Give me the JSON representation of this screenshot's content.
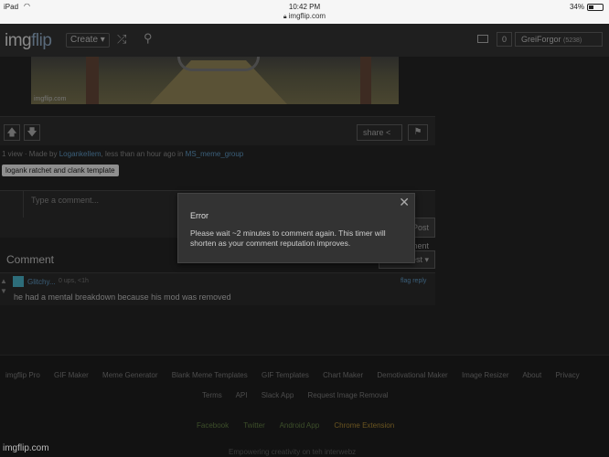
{
  "status_bar": {
    "device": "iPad",
    "time": "10:42 PM",
    "url": "imgflip.com",
    "battery": "34%"
  },
  "nav": {
    "logo_main": "img",
    "logo_accent": "flip",
    "create_label": "Create",
    "notifications": "0",
    "username": "GreiForgor",
    "user_points": "(5238)"
  },
  "meme": {
    "watermark": "imgflip.com"
  },
  "actions": {
    "share_label": "share"
  },
  "meta": {
    "views": "1 view",
    "made_by": "· Made by",
    "author": "LogankeIlem",
    "when": "less than an hour ago in",
    "stream": "MS_meme_group"
  },
  "tag": "logank ratchet and clank template",
  "comment_input": {
    "placeholder": "Type a comment...",
    "post_label": "Post Comment"
  },
  "comments": {
    "title": "Comment",
    "sort_label": "Best",
    "items": [
      {
        "user": "Glitchy...",
        "points": "0 ups, <1h",
        "links": "flag reply",
        "text": "he had a mental breakdown because his mod was removed"
      }
    ]
  },
  "footer": {
    "links_row1": [
      "imgflip Pro",
      "GIF Maker",
      "Meme Generator",
      "Blank Meme Templates",
      "GIF Templates",
      "Chart Maker",
      "Demotivational Maker",
      "Image Resizer",
      "About",
      "Privacy"
    ],
    "links_row2": [
      "Terms",
      "API",
      "Slack App",
      "Request Image Removal"
    ],
    "social": [
      "Facebook",
      "Twitter",
      "Android App",
      "Chrome Extension"
    ],
    "tagline": "Empowering creativity on teh interwebz",
    "watermark": "imgflip.com"
  },
  "modal": {
    "title": "Error",
    "message": "Please wait ~2 minutes to comment again. This timer will shorten as your comment reputation improves."
  }
}
